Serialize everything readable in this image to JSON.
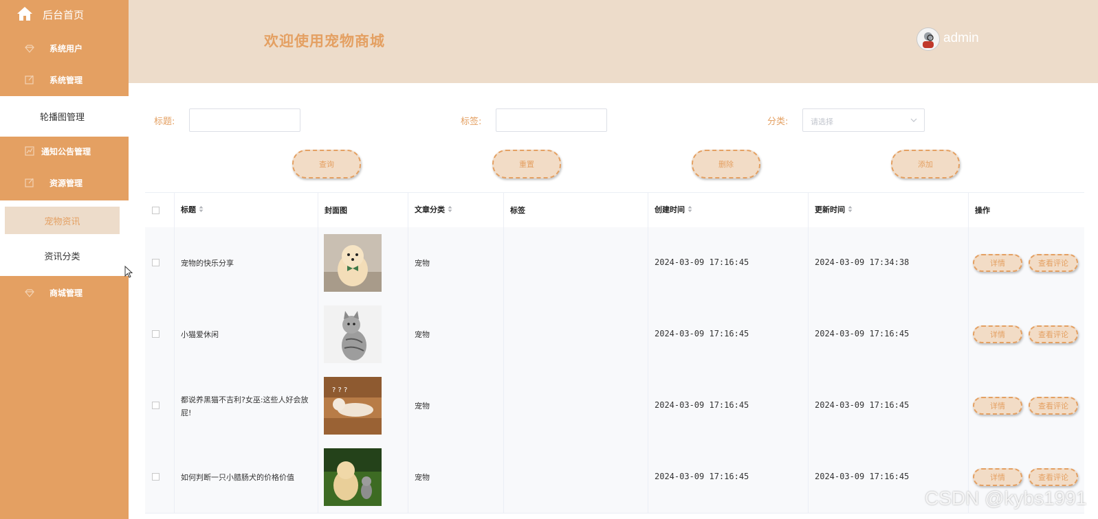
{
  "sidebar": {
    "home_label": "后台首页",
    "items": [
      {
        "label": "系统用户",
        "icon": "diamond-icon"
      },
      {
        "label": "系统管理",
        "icon": "edit-icon"
      },
      {
        "label": "通知公告管理",
        "icon": "chart-icon"
      },
      {
        "label": "资源管理",
        "icon": "edit-icon"
      },
      {
        "label": "商城管理",
        "icon": "diamond-icon"
      }
    ],
    "sub_items": {
      "carousel": "轮播图管理",
      "pet_news": "宠物资讯",
      "news_category": "资讯分类"
    }
  },
  "header": {
    "title": "欢迎使用宠物商城",
    "username": "admin"
  },
  "filters": {
    "title_label": "标题:",
    "tag_label": "标签:",
    "category_label": "分类:",
    "category_placeholder": "请选择",
    "title_value": "",
    "tag_value": ""
  },
  "buttons": {
    "query": "查询",
    "reset": "重置",
    "delete": "删除",
    "add": "添加"
  },
  "table": {
    "headers": {
      "title": "标题",
      "cover": "封面图",
      "category": "文章分类",
      "tag": "标签",
      "created": "创建时间",
      "updated": "更新时间",
      "actions": "操作"
    },
    "rows": [
      {
        "title": "宠物的快乐分享",
        "category": "宠物",
        "tag": "",
        "created": "2024-03-09 17:16:45",
        "updated": "2024-03-09 17:34:38",
        "detail": "详情",
        "comments": "查看评论"
      },
      {
        "title": "小猫爱休闲",
        "category": "宠物",
        "tag": "",
        "created": "2024-03-09 17:16:45",
        "updated": "2024-03-09 17:16:45",
        "detail": "详情",
        "comments": "查看评论"
      },
      {
        "title": "都说养黑猫不吉利?女巫:这些人好会放屁!",
        "category": "宠物",
        "tag": "",
        "created": "2024-03-09 17:16:45",
        "updated": "2024-03-09 17:16:45",
        "detail": "详情",
        "comments": "查看评论"
      },
      {
        "title": "如何判断一只小腊肠犬的价格价值",
        "category": "宠物",
        "tag": "",
        "created": "2024-03-09 17:16:45",
        "updated": "2024-03-09 17:16:45",
        "detail": "详情",
        "comments": "查看评论"
      }
    ]
  },
  "watermark": "CSDN @kybs1991",
  "colors": {
    "sidebar": "#e4a062",
    "header": "#eddcca",
    "accent": "#e4a062"
  }
}
